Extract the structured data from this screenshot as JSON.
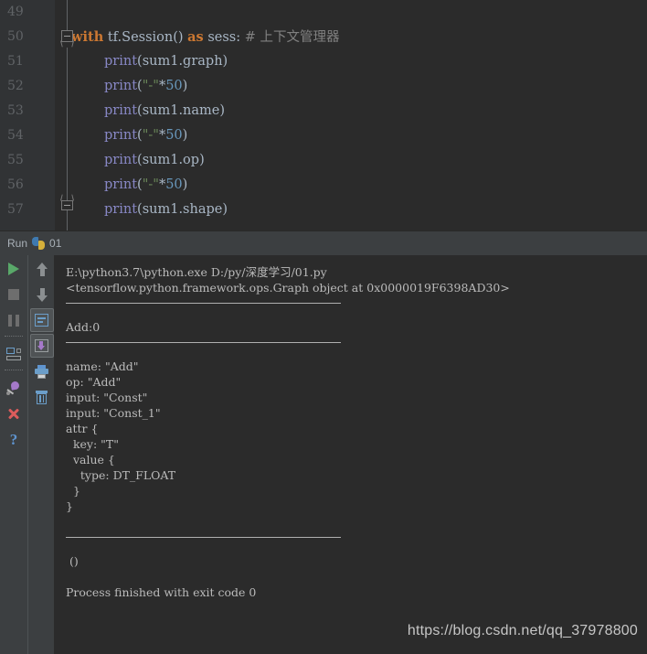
{
  "editor": {
    "lines": [
      {
        "num": "49",
        "tokens": []
      },
      {
        "num": "50",
        "tokens": [
          {
            "t": "with",
            "c": "kw"
          },
          {
            "t": " ",
            "c": "punct"
          },
          {
            "t": "tf.Session()",
            "c": "ident"
          },
          {
            "t": " ",
            "c": "punct"
          },
          {
            "t": "as",
            "c": "kw"
          },
          {
            "t": " sess:",
            "c": "ident"
          },
          {
            "t": " # 上下文管理器",
            "c": "cmt"
          }
        ],
        "indent": 0,
        "fold": "open"
      },
      {
        "num": "51",
        "tokens": [
          {
            "t": "print",
            "c": "fn"
          },
          {
            "t": "(sum1.graph)",
            "c": "ident"
          }
        ],
        "indent": 1
      },
      {
        "num": "52",
        "tokens": [
          {
            "t": "print",
            "c": "fn"
          },
          {
            "t": "(",
            "c": "punct"
          },
          {
            "t": "\"-\"",
            "c": "str"
          },
          {
            "t": "*",
            "c": "punct"
          },
          {
            "t": "50",
            "c": "num"
          },
          {
            "t": ")",
            "c": "punct"
          }
        ],
        "indent": 1
      },
      {
        "num": "53",
        "tokens": [
          {
            "t": "print",
            "c": "fn"
          },
          {
            "t": "(sum1.name)",
            "c": "ident"
          }
        ],
        "indent": 1
      },
      {
        "num": "54",
        "tokens": [
          {
            "t": "print",
            "c": "fn"
          },
          {
            "t": "(",
            "c": "punct"
          },
          {
            "t": "\"-\"",
            "c": "str"
          },
          {
            "t": "*",
            "c": "punct"
          },
          {
            "t": "50",
            "c": "num"
          },
          {
            "t": ")",
            "c": "punct"
          }
        ],
        "indent": 1
      },
      {
        "num": "55",
        "tokens": [
          {
            "t": "print",
            "c": "fn"
          },
          {
            "t": "(sum1.op)",
            "c": "ident"
          }
        ],
        "indent": 1
      },
      {
        "num": "56",
        "tokens": [
          {
            "t": "print",
            "c": "fn"
          },
          {
            "t": "(",
            "c": "punct"
          },
          {
            "t": "\"-\"",
            "c": "str"
          },
          {
            "t": "*",
            "c": "punct"
          },
          {
            "t": "50",
            "c": "num"
          },
          {
            "t": ")",
            "c": "punct"
          }
        ],
        "indent": 1
      },
      {
        "num": "57",
        "tokens": [
          {
            "t": "print",
            "c": "fn"
          },
          {
            "t": "(sum1.shape)",
            "c": "ident"
          }
        ],
        "indent": 1,
        "fold": "close"
      }
    ]
  },
  "run_tab": {
    "label": "Run",
    "icon": "python-icon",
    "config_name": "01"
  },
  "toolbar_left": {
    "buttons": [
      {
        "name": "rerun-button",
        "icon": "play-icon",
        "pressed": false
      },
      {
        "name": "stop-button",
        "icon": "stop-icon",
        "pressed": false
      },
      {
        "name": "pause-button",
        "icon": "pause-icon",
        "pressed": false
      },
      {
        "name": "show-console-button",
        "icon": "console-icon",
        "pressed": false
      },
      {
        "name": "pin-tab-button",
        "icon": "pin-icon",
        "pressed": false
      },
      {
        "name": "close-tab-button",
        "icon": "close-x-icon",
        "pressed": false
      },
      {
        "name": "help-button",
        "icon": "question-mark-icon",
        "pressed": false
      }
    ]
  },
  "toolbar_right": {
    "buttons": [
      {
        "name": "up-the-stack-button",
        "icon": "arrow-up-icon",
        "pressed": false
      },
      {
        "name": "down-the-stack-button",
        "icon": "arrow-down-icon",
        "pressed": false
      },
      {
        "name": "soft-wrap-button",
        "icon": "soft-wrap-icon",
        "pressed": true
      },
      {
        "name": "scroll-to-end-button",
        "icon": "scroll-to-end-icon",
        "pressed": true
      },
      {
        "name": "print-button",
        "icon": "printer-icon",
        "pressed": false
      },
      {
        "name": "clear-all-button",
        "icon": "trash-icon",
        "pressed": false
      }
    ]
  },
  "console": {
    "lines": [
      {
        "type": "text",
        "text": "E:\\python3.7\\python.exe D:/py/深度学习/01.py"
      },
      {
        "type": "text",
        "text": "<tensorflow.python.framework.ops.Graph object at 0x0000019F6398AD30>"
      },
      {
        "type": "rule",
        "text": "--------------------------------------------------"
      },
      {
        "type": "text",
        "text": "Add:0"
      },
      {
        "type": "rule",
        "text": "--------------------------------------------------"
      },
      {
        "type": "text",
        "text": "name: \"Add\""
      },
      {
        "type": "text",
        "text": "op: \"Add\""
      },
      {
        "type": "text",
        "text": "input: \"Const\""
      },
      {
        "type": "text",
        "text": "input: \"Const_1\""
      },
      {
        "type": "text",
        "text": "attr {"
      },
      {
        "type": "text",
        "text": "  key: \"T\""
      },
      {
        "type": "text",
        "text": "  value {"
      },
      {
        "type": "text",
        "text": "    type: DT_FLOAT"
      },
      {
        "type": "text",
        "text": "  }"
      },
      {
        "type": "text",
        "text": "}"
      },
      {
        "type": "blank",
        "text": ""
      },
      {
        "type": "rule",
        "text": "--------------------------------------------------"
      },
      {
        "type": "text",
        "text": " ()"
      },
      {
        "type": "blank",
        "text": ""
      },
      {
        "type": "text",
        "text": "Process finished with exit code 0"
      }
    ]
  },
  "watermark": {
    "text": "https://blog.csdn.net/qq_37978800"
  },
  "colors": {
    "editor_bg": "#2b2b2b",
    "gutter_bg": "#313335",
    "panel_bg": "#3c3f41",
    "keyword": "#cc7832",
    "function": "#8888c6",
    "string": "#6a8759",
    "number": "#6897bb",
    "comment": "#808080",
    "console_text": "#bbbbbb",
    "run_green": "#59a869",
    "close_red": "#db5c5c"
  }
}
